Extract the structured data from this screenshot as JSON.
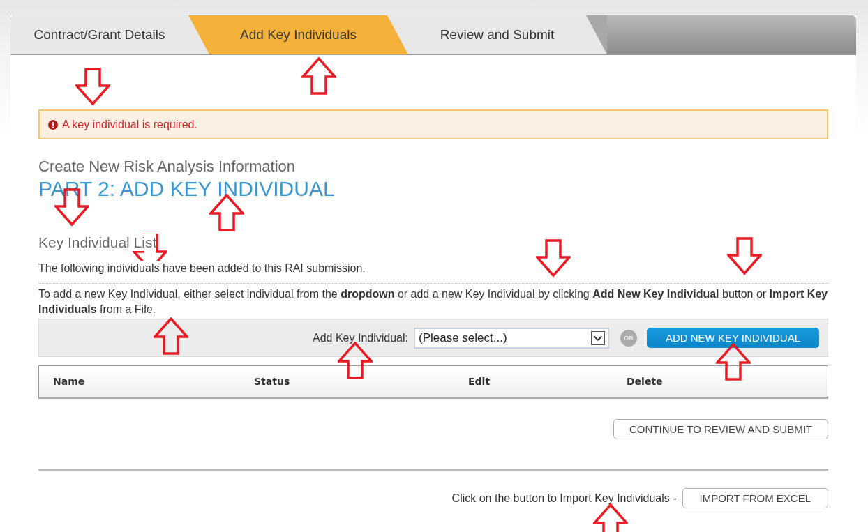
{
  "tabs": [
    {
      "label": "Contract/Grant Details",
      "selected": false
    },
    {
      "label": "Add Key Individuals",
      "selected": true
    },
    {
      "label": "Review and Submit",
      "selected": false
    }
  ],
  "alert": {
    "kind": "error",
    "message": "A key individual is required."
  },
  "page_title": "Create New Risk Analysis Information",
  "part_title": "PART 2: ADD KEY INDIVIDUAL",
  "section_title": "Key Individual List",
  "intro": "The following individuals have been added to this RAI submission.",
  "instructions": "To add a new Key Individual, either select individual from the **dropdown** or add a new Key Individual by clicking **Add New Key Individual** button or **Import Key Individuals** from a File.",
  "toolbar": {
    "label": "Add Key Individual:",
    "select": {
      "value": "(Please select...)"
    },
    "or_badge": "OR",
    "add_button": "ADD NEW KEY INDIVIDUAL"
  },
  "table": {
    "columns": [
      "Name",
      "Status",
      "Edit",
      "Delete"
    ]
  },
  "continue_button": "CONTINUE TO REVIEW AND SUBMIT",
  "import": {
    "text": "Click on the button to Import Key Individuals -",
    "button": "IMPORT FROM EXCEL"
  }
}
